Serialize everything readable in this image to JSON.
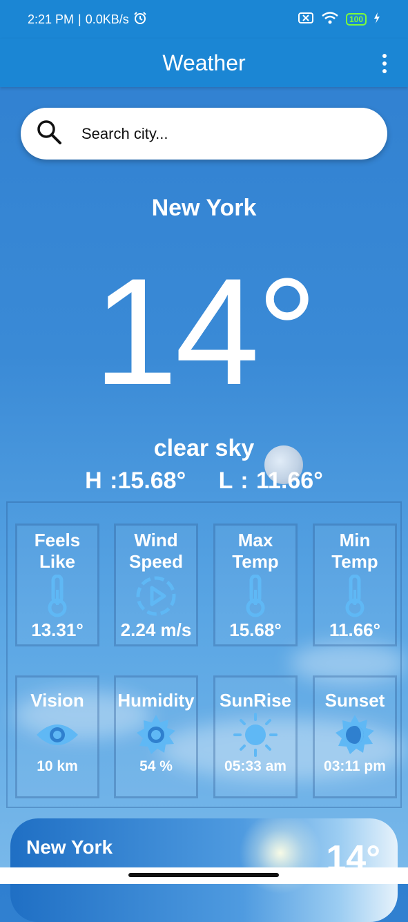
{
  "status": {
    "time": "2:21 PM",
    "network_speed": "0.0KB/s",
    "battery": "100",
    "icons": [
      "alarm-icon",
      "sim-icon",
      "wifi-icon",
      "battery-icon",
      "charging-icon"
    ]
  },
  "appbar": {
    "title": "Weather",
    "menu_icon": "more-vertical-icon"
  },
  "search": {
    "placeholder": "Search city...",
    "value": "",
    "icon": "search-icon"
  },
  "current": {
    "city": "New York",
    "temperature": "14°",
    "description": "clear sky",
    "high": "H :15.68°",
    "low": "L : 11.66°"
  },
  "details": [
    {
      "label": "Feels Like",
      "value": "13.31°",
      "icon": "thermometer-icon"
    },
    {
      "label": "Wind Speed",
      "value": "2.24 m/s",
      "icon": "wind-speed-icon"
    },
    {
      "label": "Max Temp",
      "value": "15.68°",
      "icon": "thermometer-icon"
    },
    {
      "label": "Min Temp",
      "value": "11.66°",
      "icon": "thermometer-icon"
    },
    {
      "label": "Vision",
      "value": "10 km",
      "icon": "eye-icon"
    },
    {
      "label": "Humidity",
      "value": "54 %",
      "icon": "humidity-sun-icon"
    },
    {
      "label": "SunRise",
      "value": "05:33 am",
      "icon": "sunrise-icon"
    },
    {
      "label": "Sunset",
      "value": "03:11 pm",
      "icon": "sunset-icon"
    }
  ],
  "bottom_card": {
    "city": "New York",
    "temperature": "14°"
  },
  "colors": {
    "appbar": "#1b86d4",
    "icon": "#5fb8f5",
    "text": "#ffffff"
  }
}
